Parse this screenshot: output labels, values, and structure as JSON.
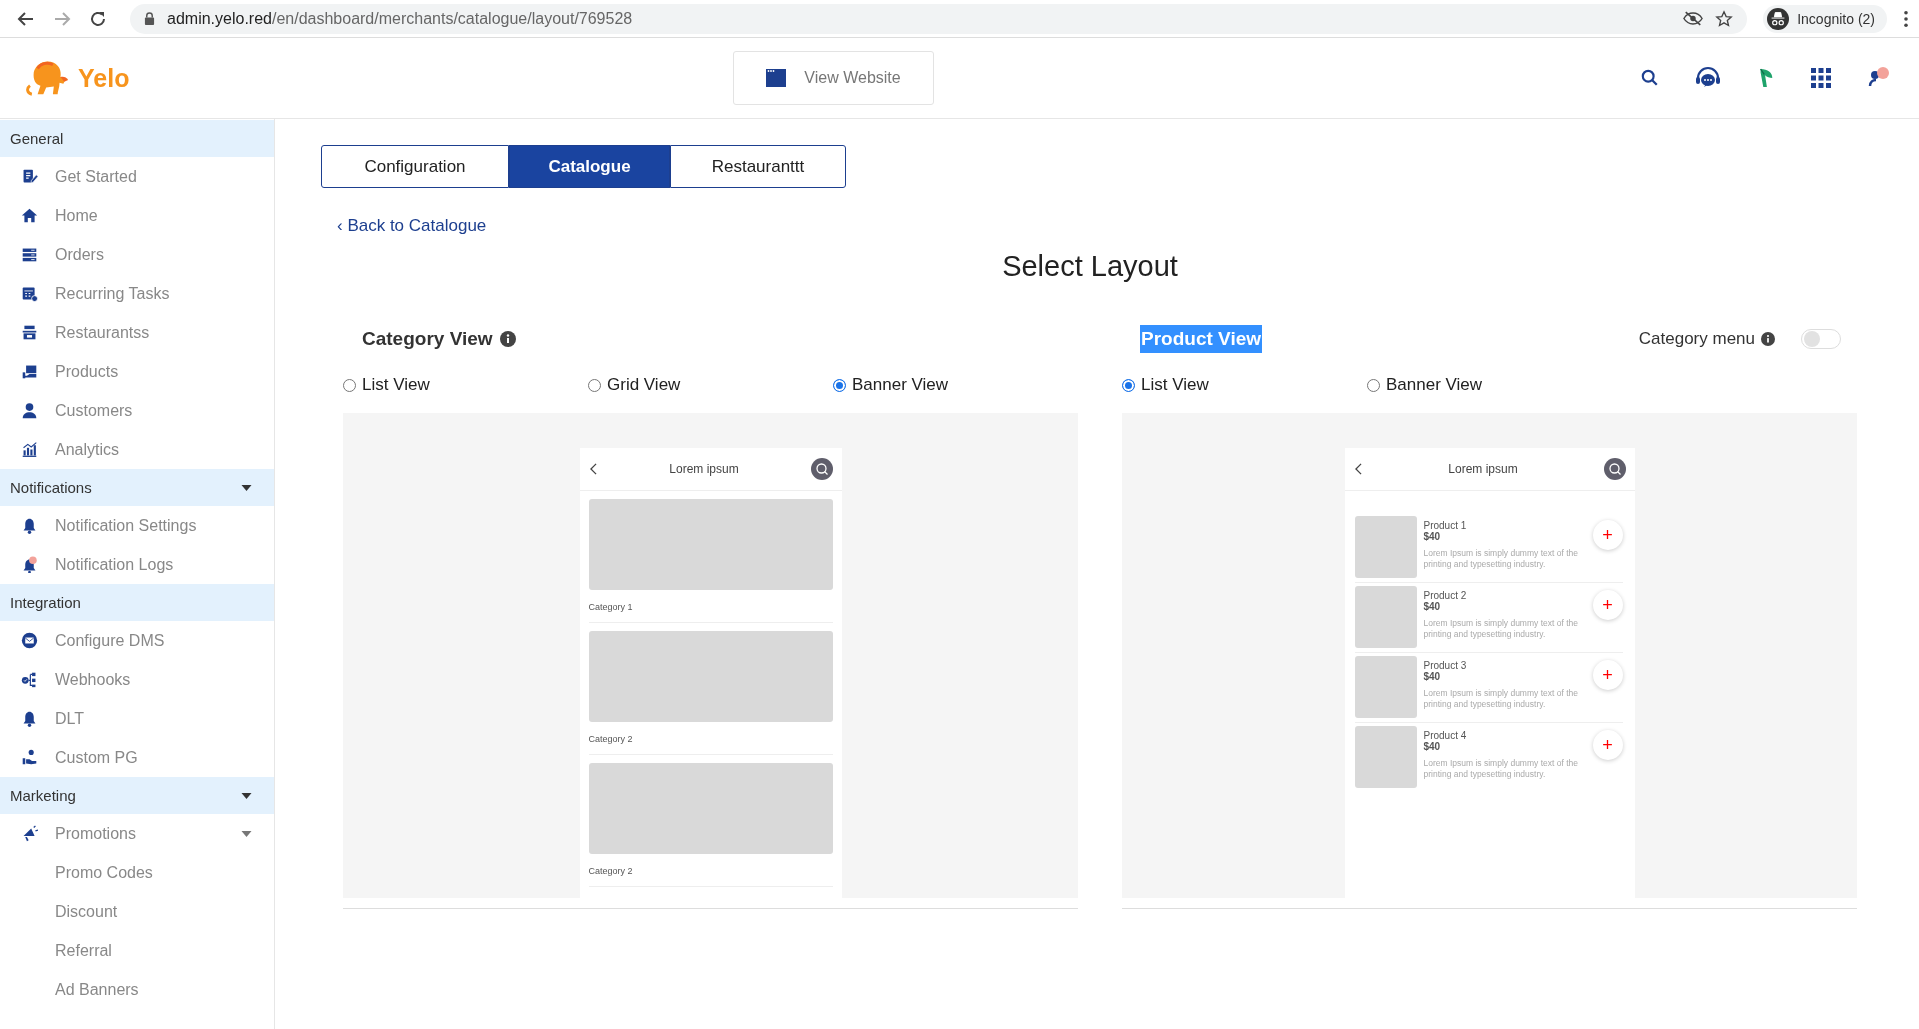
{
  "browser": {
    "url_host": "admin.yelo.red",
    "url_path": "/en/dashboard/merchants/catalogue/layout/769528",
    "profile": "Incognito (2)"
  },
  "header": {
    "brand": "Yelo",
    "view_website": "View Website"
  },
  "sidebar": {
    "sections": [
      {
        "title": "General",
        "expandable": false,
        "items": [
          {
            "label": "Get Started"
          },
          {
            "label": "Home"
          },
          {
            "label": "Orders"
          },
          {
            "label": "Recurring Tasks"
          },
          {
            "label": "Restaurantss"
          },
          {
            "label": "Products"
          },
          {
            "label": "Customers"
          },
          {
            "label": "Analytics"
          }
        ]
      },
      {
        "title": "Notifications",
        "expandable": true,
        "items": [
          {
            "label": "Notification Settings"
          },
          {
            "label": "Notification Logs"
          }
        ]
      },
      {
        "title": "Integration",
        "expandable": false,
        "items": [
          {
            "label": "Configure DMS"
          },
          {
            "label": "Webhooks"
          },
          {
            "label": "DLT"
          },
          {
            "label": "Custom PG"
          }
        ]
      },
      {
        "title": "Marketing",
        "expandable": true,
        "items": [
          {
            "label": "Promotions",
            "expandable": true,
            "children": [
              {
                "label": "Promo Codes"
              },
              {
                "label": "Discount"
              },
              {
                "label": "Referral"
              },
              {
                "label": "Ad Banners"
              }
            ]
          }
        ]
      }
    ]
  },
  "tabs": [
    {
      "label": "Configuration",
      "selected": false
    },
    {
      "label": "Catalogue",
      "selected": true
    },
    {
      "label": "Restauranttt",
      "selected": false
    }
  ],
  "back_link": "‹ Back to Catalogue",
  "title": "Select Layout",
  "category_view": {
    "title": "Category View",
    "text_selected": false,
    "options": [
      {
        "label": "List View",
        "selected": false
      },
      {
        "label": "Grid View",
        "selected": false
      },
      {
        "label": "Banner View",
        "selected": true
      }
    ],
    "preview": {
      "kind": "banners",
      "header": "Lorem ipsum",
      "items": [
        "Category 1",
        "Category 2",
        "Category 2"
      ]
    }
  },
  "product_view": {
    "title": "Product View",
    "text_selected": true,
    "category_menu": {
      "label": "Category menu",
      "on": false
    },
    "options": [
      {
        "label": "List View",
        "selected": true
      },
      {
        "label": "Banner View",
        "selected": false
      }
    ],
    "preview": {
      "kind": "products",
      "header": "Lorem ipsum",
      "products": [
        {
          "name": "Product 1",
          "price": "$40",
          "description": "Lorem Ipsum is simply dummy text of the printing and typesetting industry.",
          "add": "+"
        },
        {
          "name": "Product 2",
          "price": "$40",
          "description": "Lorem Ipsum is simply dummy text of the printing and typesetting industry.",
          "add": "+"
        },
        {
          "name": "Product 3",
          "price": "$40",
          "description": "Lorem Ipsum is simply dummy text of the printing and typesetting industry.",
          "add": "+"
        },
        {
          "name": "Product 4",
          "price": "$40",
          "description": "Lorem Ipsum is simply dummy text of the printing and typesetting industry.",
          "add": "+"
        }
      ]
    }
  }
}
